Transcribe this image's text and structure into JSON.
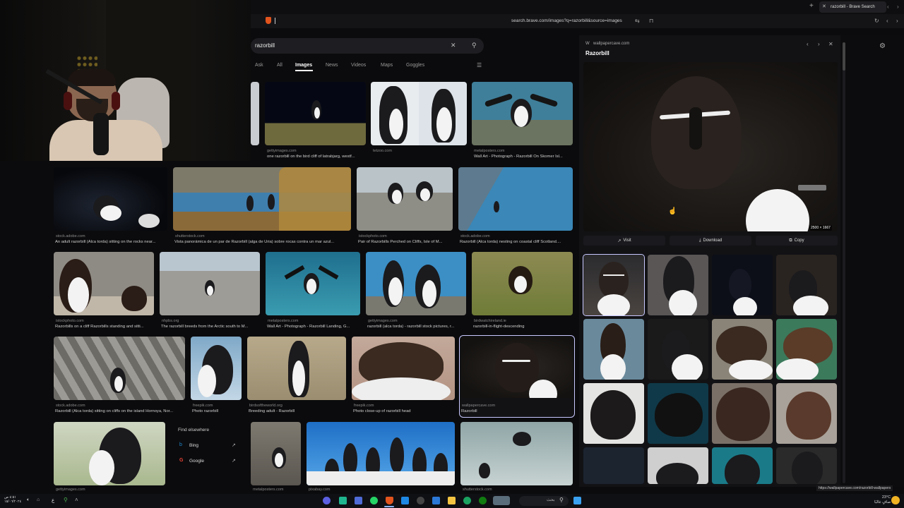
{
  "browser": {
    "tab_title": "razorbill - Brave Search",
    "url": "search.brave.com/images?q=razorbill&source=images",
    "status_url": "https://wallpapercave.com/razorbill-wallpapers"
  },
  "search": {
    "query": "razorbill",
    "tabs": [
      "Ask",
      "All",
      "Images",
      "News",
      "Videos",
      "Maps",
      "Goggles"
    ],
    "active_tab": "Images"
  },
  "results": [
    {
      "source": "gettyimages.com",
      "caption": "one razorbill on the bird cliff of latrabjarg, westf..."
    },
    {
      "source": "tetzoo.com",
      "caption": ""
    },
    {
      "source": "metalposters.com",
      "caption": "Wall Art - Photograph - Razorbill On Skomer Isl..."
    },
    {
      "source": "stock.adobe.com",
      "caption": "An adult razorbill (Alca torda) sitting on the rocks near..."
    },
    {
      "source": "shutterstock.com",
      "caption": "Vista panorámica de un par de Razorbill (alga de Uria) sobre rocas contra un mar azul..."
    },
    {
      "source": "istockphoto.com",
      "caption": "Pair of Razorbills Perched on Cliffs, Isle of M..."
    },
    {
      "source": "stock.adobe.com",
      "caption": "Razorbill (Alca torda) nesting on coastal cliff Scotland...."
    },
    {
      "source": "istockphoto.com",
      "caption": "Razorbills on a cliff Razorbills standing and sitti..."
    },
    {
      "source": "nhpbs.org",
      "caption": "The razorbill breeds from the Arctic south to M..."
    },
    {
      "source": "metalposters.com",
      "caption": "Wall Art - Photograph - Razorbill Landing, G..."
    },
    {
      "source": "gettyimages.com",
      "caption": "razorbill (alca torda) - razorbill stock pictures, r..."
    },
    {
      "source": "birdwatchireland.ie",
      "caption": "razorbill-in-flight-descending"
    },
    {
      "source": "stock.adobe.com",
      "caption": "Razorbill (Alca torda) sitting on cliffs on the island Hornoya, Nor..."
    },
    {
      "source": "freepik.com",
      "caption": "Photo razorbill"
    },
    {
      "source": "birdsoftheworld.org",
      "caption": "Breeding adult - Razorbill"
    },
    {
      "source": "freepik.com",
      "caption": "Photo close-up of razorbill head"
    },
    {
      "source": "wallpapercave.com",
      "caption": "Razorbill"
    },
    {
      "source": "gettyimages.com",
      "caption": ""
    },
    {
      "source": "metalposters.com",
      "caption": ""
    },
    {
      "source": "pixabay.com",
      "caption": ""
    },
    {
      "source": "shutterstock.com",
      "caption": ""
    }
  ],
  "find_elsewhere": {
    "title": "Find elsewhere",
    "items": [
      "Bing",
      "Google"
    ]
  },
  "preview": {
    "source": "wallpapercave.com",
    "title": "Razorbill",
    "dimensions": "2500 × 1667",
    "actions": [
      "Visit",
      "Download",
      "Copy"
    ]
  },
  "taskbar": {
    "weather_temp": "23°C",
    "weather_label": "صافٍ غالبًا",
    "time": "٤:٥١ ص",
    "date": "١٥/٠٦/٢٠٢٤",
    "lang": "ع",
    "search_label": "بحث"
  },
  "colors": {
    "accent": "#e2541d",
    "selected_outline": "#c8c8ff",
    "background": "#0b0b0d"
  }
}
